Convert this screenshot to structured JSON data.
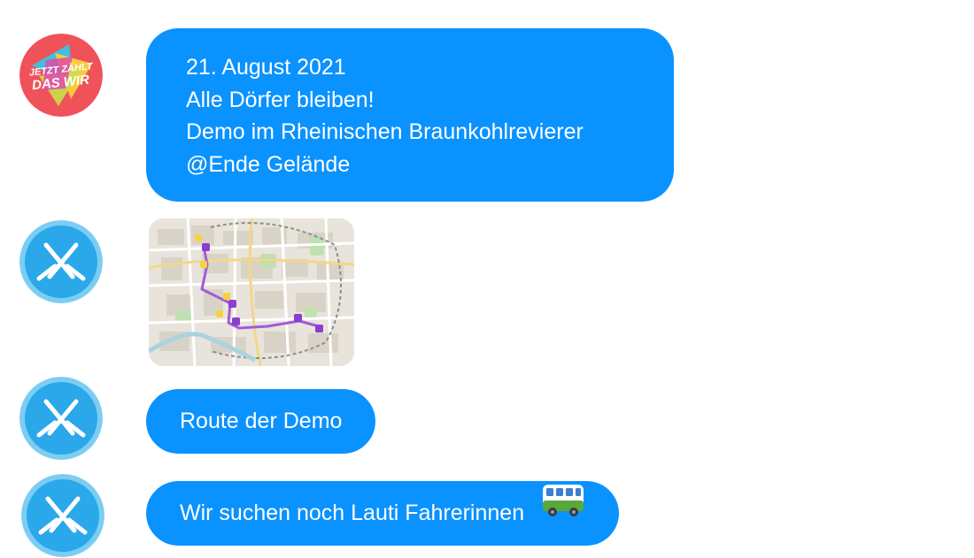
{
  "messages": [
    {
      "avatar": "campaign-logo",
      "avatar_text": [
        "JETZT ZÄHLT",
        "DAS WIR"
      ],
      "lines": [
        "21. August 2021",
        "Alle Dörfer bleiben!",
        "Demo im Rheinischen Braunkohlrevierer",
        "@Ende Gelände"
      ]
    },
    {
      "avatar": "crossed-hammers-icon",
      "type": "map-image"
    },
    {
      "avatar": "crossed-hammers-icon",
      "text": "Route der Demo"
    },
    {
      "avatar": "crossed-hammers-icon",
      "text": "Wir suchen noch Lauti Fahrerinnen",
      "emoji": "bus-icon"
    }
  ],
  "colors": {
    "bubble": "#0a92ff",
    "bubble_text": "#ffffff",
    "avatar_blue": "#2aa8ea",
    "avatar_ring": "#7ccdf3",
    "logo_bg": "#f0525a",
    "route": "#a25bd8"
  }
}
